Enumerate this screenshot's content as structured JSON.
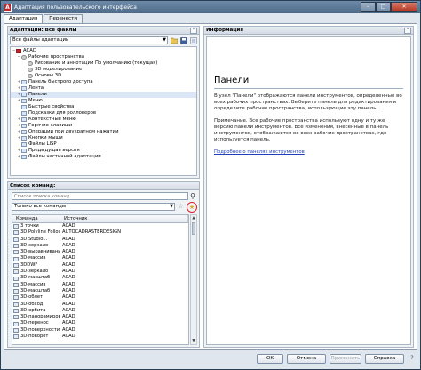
{
  "window": {
    "title": "Адаптация пользовательского интерфейса",
    "app_icon": "A",
    "minimize": "–",
    "maximize": "□",
    "close": "✕"
  },
  "tabs": [
    {
      "label": "Адаптация"
    },
    {
      "label": "Перенести"
    }
  ],
  "left_top": {
    "header": "Адаптации: Все файлы",
    "collapse": "⌃",
    "filter_value": "Все файлы адаптации",
    "tree": [
      {
        "label": "ACAD",
        "level": 0,
        "exp": "−"
      },
      {
        "label": "Рабочие пространства",
        "level": 1,
        "exp": "−"
      },
      {
        "label": "Рисование и аннотации По умолчанию (текущая)",
        "level": 2,
        "exp": ""
      },
      {
        "label": "3D моделирование",
        "level": 2,
        "exp": ""
      },
      {
        "label": "Основы 3D",
        "level": 2,
        "exp": ""
      },
      {
        "label": "Панель быстрого доступа",
        "level": 1,
        "exp": "+"
      },
      {
        "label": "Лента",
        "level": 1,
        "exp": "+"
      },
      {
        "label": "Панели",
        "level": 1,
        "exp": "+"
      },
      {
        "label": "Меню",
        "level": 1,
        "exp": "+"
      },
      {
        "label": "Быстрые свойства",
        "level": 1,
        "exp": ""
      },
      {
        "label": "Подсказки для ролловеров",
        "level": 1,
        "exp": ""
      },
      {
        "label": "Контекстные меню",
        "level": 1,
        "exp": "+"
      },
      {
        "label": "Горячие клавиши",
        "level": 1,
        "exp": "+"
      },
      {
        "label": "Операции при двукратном нажатии",
        "level": 1,
        "exp": "+"
      },
      {
        "label": "Кнопки мыши",
        "level": 1,
        "exp": "+"
      },
      {
        "label": "Файлы LISP",
        "level": 1,
        "exp": ""
      },
      {
        "label": "Предыдущая версия",
        "level": 1,
        "exp": "+"
      },
      {
        "label": "Файлы частичной адаптации",
        "level": 1,
        "exp": "+"
      }
    ]
  },
  "commands": {
    "header": "Список команд:",
    "search_placeholder": "Список поиска команд",
    "filter_value": "Только все команды",
    "col_command": "Команда",
    "col_source": "Источник",
    "rows": [
      {
        "name": "3 точки",
        "source": "ACAD"
      },
      {
        "name": "3D Polyline Follower",
        "source": "AUTOCADRASTERDESIGN"
      },
      {
        "name": "3D Studio...",
        "source": "ACAD"
      },
      {
        "name": "3D-зеркало",
        "source": "ACAD"
      },
      {
        "name": "3D-выравнивание",
        "source": "ACAD"
      },
      {
        "name": "3D-массив",
        "source": "ACAD"
      },
      {
        "name": "3DDWF",
        "source": "ACAD"
      },
      {
        "name": "3D-зеркало",
        "source": "ACAD"
      },
      {
        "name": "3D-масштаб",
        "source": "ACAD"
      },
      {
        "name": "3D-массив",
        "source": "ACAD"
      },
      {
        "name": "3D-масштаб",
        "source": "ACAD"
      },
      {
        "name": "3D-облет",
        "source": "ACAD"
      },
      {
        "name": "3D-обход",
        "source": "ACAD"
      },
      {
        "name": "3D-орбита",
        "source": "ACAD"
      },
      {
        "name": "3D-панорамирован...",
        "source": "ACAD"
      },
      {
        "name": "3D-перенос",
        "source": "ACAD"
      },
      {
        "name": "3D-поверхности...",
        "source": "ACAD"
      },
      {
        "name": "3D-поворот",
        "source": "ACAD"
      }
    ]
  },
  "info": {
    "header": "Информация",
    "collapse": "⌃",
    "title": "Панели",
    "p1": "В узел \"Панели\" отображаются панели инструментов, определенные во всех рабочих пространствах. Выберите панель для редактирования и определите рабочие пространства, использующие эту панель.",
    "p2": "Примечание. Все рабочие пространства используют одну и ту же версию панели инструментов. Все изменения, внесенные в панель инструментов, отображаются во всех рабочих пространствах, где используется панель.",
    "link": "Подробнее о панелях инструментов"
  },
  "buttons": {
    "ok": "OK",
    "cancel": "Отмена",
    "apply": "Применить",
    "help": "Справка",
    "help_icon": "?"
  }
}
